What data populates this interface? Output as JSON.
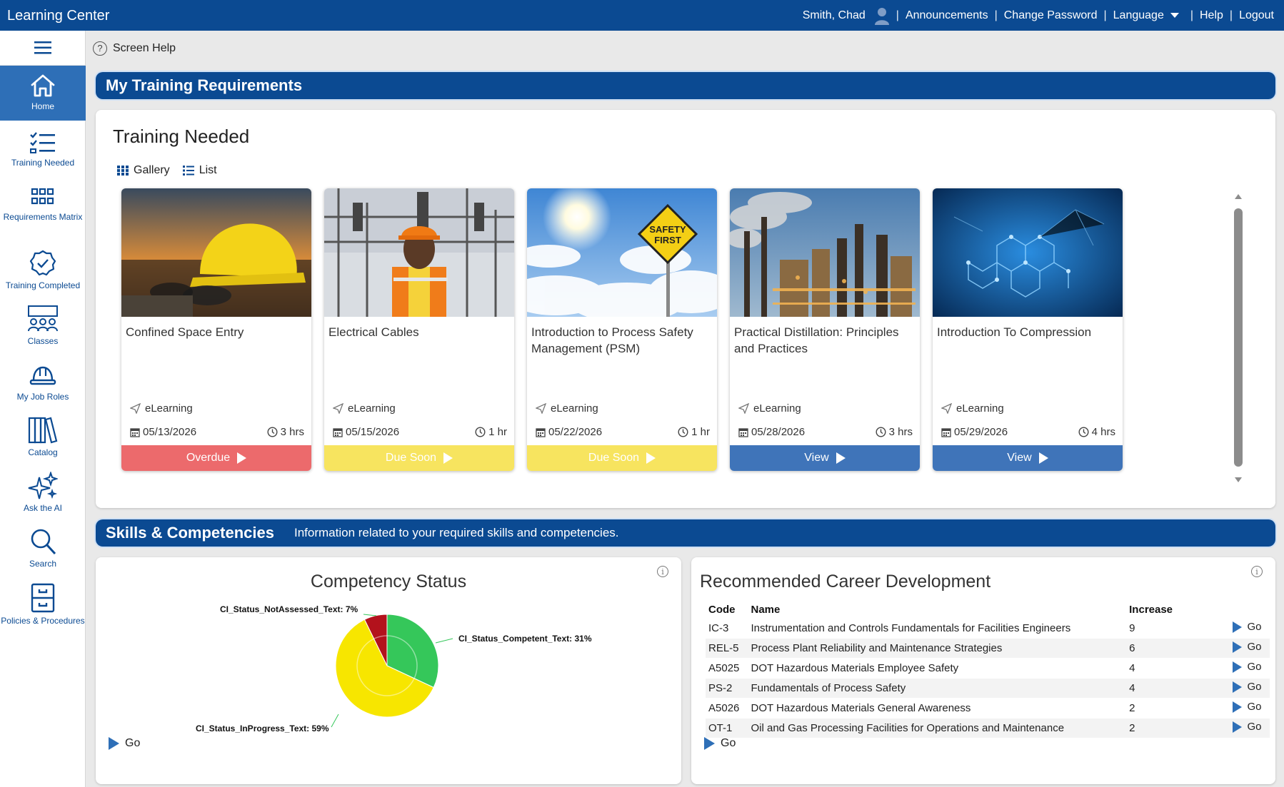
{
  "topbar": {
    "brand": "Learning Center",
    "user": "Smith, Chad",
    "links": [
      "Announcements",
      "Change Password",
      "Language",
      "Help",
      "Logout"
    ]
  },
  "sidebar": {
    "items": [
      {
        "label": "Home",
        "icon": "home-icon"
      },
      {
        "label": "Training Needed",
        "icon": "checklist-icon"
      },
      {
        "label": "Requirements Matrix",
        "icon": "grid-icon"
      },
      {
        "label": "Training Completed",
        "icon": "badge-check-icon"
      },
      {
        "label": "Classes",
        "icon": "classroom-icon"
      },
      {
        "label": "My Job Roles",
        "icon": "hardhat-icon"
      },
      {
        "label": "Catalog",
        "icon": "books-icon"
      },
      {
        "label": "Ask the AI",
        "icon": "sparkle-icon"
      },
      {
        "label": "Search",
        "icon": "search-icon"
      },
      {
        "label": "Policies & Procedures",
        "icon": "cabinet-icon"
      }
    ]
  },
  "help": {
    "label": "Screen Help"
  },
  "requirements": {
    "header": "My Training Requirements",
    "title": "Training Needed",
    "view_gallery": "Gallery",
    "view_list": "List",
    "cards": [
      {
        "title": "Confined Space Entry",
        "type": "eLearning",
        "date": "05/13/2026",
        "duration": "3 hrs",
        "action": "Overdue",
        "status_color": "#ec6a6c"
      },
      {
        "title": "Electrical Cables",
        "type": "eLearning",
        "date": "05/15/2026",
        "duration": "1 hr",
        "action": "Due Soon",
        "status_color": "#f7e45f"
      },
      {
        "title": "Introduction to Process Safety Management (PSM)",
        "type": "eLearning",
        "date": "05/22/2026",
        "duration": "1 hr",
        "action": "Due Soon",
        "status_color": "#f7e45f"
      },
      {
        "title": "Practical Distillation: Principles and Practices",
        "type": "eLearning",
        "date": "05/28/2026",
        "duration": "3 hrs",
        "action": "View",
        "status_color": "#3f74b9"
      },
      {
        "title": "Introduction To Compression",
        "type": "eLearning",
        "date": "05/29/2026",
        "duration": "4 hrs",
        "action": "View",
        "status_color": "#3f74b9"
      }
    ]
  },
  "skills": {
    "header": "Skills & Competencies",
    "subheader": "Information related to your required skills and competencies."
  },
  "competency": {
    "title": "Competency Status",
    "go": "Go",
    "chart_data": {
      "type": "pie",
      "slices": [
        {
          "label": "CI_Status_Competent_Text: 31%",
          "value": 31,
          "color": "#35c75a"
        },
        {
          "label": "CI_Status_InProgress_Text: 59%",
          "value": 59,
          "color": "#f7e600"
        },
        {
          "label": "CI_Status_NotAssessed_Text: 7%",
          "value": 7,
          "color": "#b3121c"
        }
      ]
    }
  },
  "career": {
    "title": "Recommended Career Development",
    "columns": [
      "Code",
      "Name",
      "Increase"
    ],
    "rows": [
      {
        "code": "IC-3",
        "name": "Instrumentation and Controls Fundamentals for Facilities Engineers",
        "increase": "9",
        "go": "Go"
      },
      {
        "code": "REL-5",
        "name": "Process Plant Reliability and Maintenance Strategies",
        "increase": "6",
        "go": "Go"
      },
      {
        "code": "A5025",
        "name": "DOT Hazardous Materials Employee Safety",
        "increase": "4",
        "go": "Go"
      },
      {
        "code": "PS-2",
        "name": "Fundamentals of Process Safety",
        "increase": "4",
        "go": "Go"
      },
      {
        "code": "A5026",
        "name": "DOT Hazardous Materials General Awareness",
        "increase": "2",
        "go": "Go"
      },
      {
        "code": "OT-1",
        "name": "Oil and Gas Processing Facilities for Operations and Maintenance",
        "increase": "2",
        "go": "Go"
      }
    ],
    "go": "Go"
  }
}
